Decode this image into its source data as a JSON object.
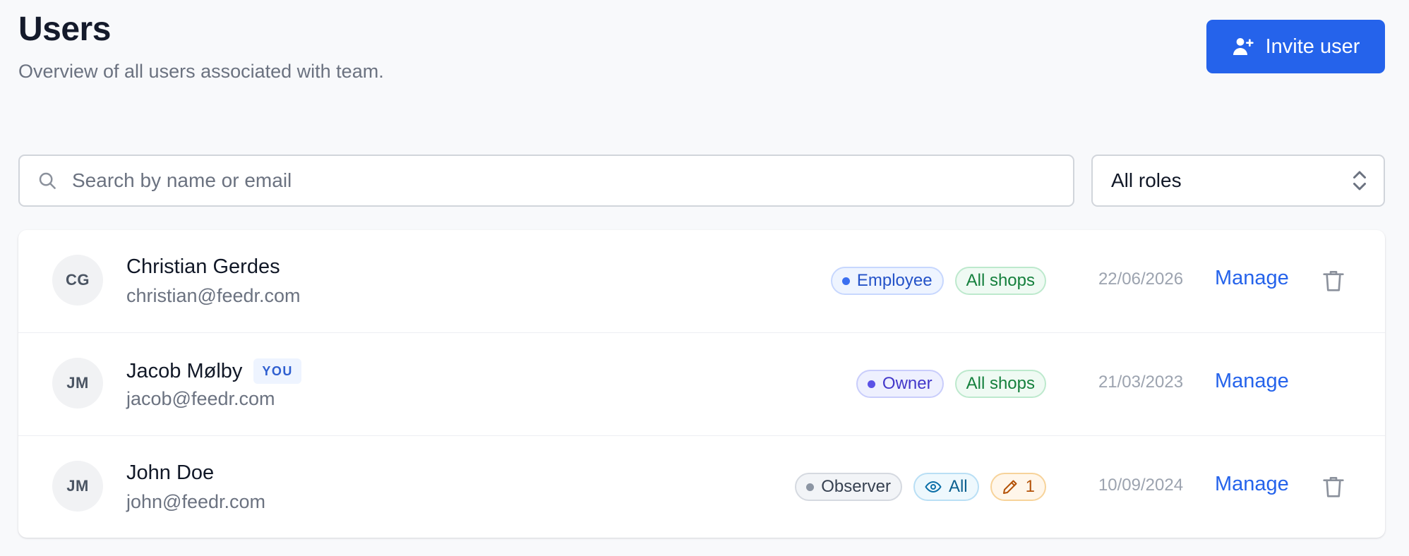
{
  "header": {
    "title": "Users",
    "subtitle": "Overview of all users associated with team.",
    "invite_button_label": "Invite user",
    "invite_icon": "user-plus-icon"
  },
  "filters": {
    "search": {
      "placeholder": "Search by name or email",
      "value": "",
      "icon": "search-icon"
    },
    "role_select": {
      "selected": "All roles",
      "icon": "chevron-up-down-icon"
    }
  },
  "users": [
    {
      "initials": "CG",
      "name": "Christian Gerdes",
      "email": "christian@feedr.com",
      "role_badge": "Employee",
      "access_badge": "All shops",
      "date": "22/06/2026",
      "action_label": "Manage",
      "delete_icon": "trash-icon"
    },
    {
      "initials": "JM",
      "name": "Jacob Mølby",
      "you_label": "YOU",
      "email": "jacob@feedr.com",
      "role_badge": "Owner",
      "access_badge": "All shops",
      "date": "21/03/2023",
      "action_label": "Manage"
    },
    {
      "initials": "JM",
      "name": "John Doe",
      "email": "john@feedr.com",
      "role_badge": "Observer",
      "view_badge": "All",
      "view_icon": "eye-icon",
      "edit_badge": "1",
      "edit_icon": "pencil-icon",
      "date": "10/09/2024",
      "action_label": "Manage",
      "delete_icon": "trash-icon"
    }
  ],
  "colors": {
    "accent": "#2563eb",
    "page_background": "#f8f9fb",
    "employee_badge": "#3b6ff0",
    "owner_badge": "#5b52e6",
    "shops_badge": "#15803d",
    "observer_badge": "#8c95a3",
    "view_badge": "#0b5f8f",
    "edit_badge": "#b45309"
  }
}
